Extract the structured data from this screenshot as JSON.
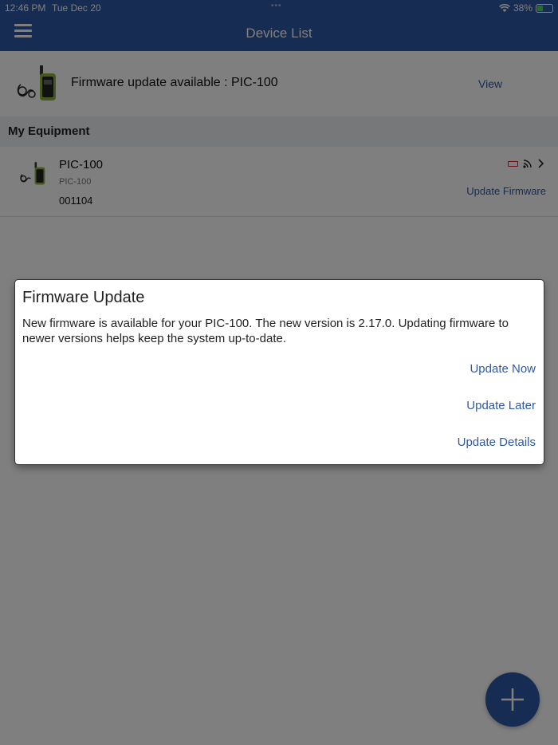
{
  "status_bar": {
    "time": "12:46 PM",
    "date": "Tue Dec 20",
    "battery": "38%",
    "battery_level": 0.38
  },
  "header": {
    "title": "Device List",
    "menu_icon": "hamburger-menu-icon"
  },
  "firmware_banner": {
    "text": "Firmware update available : PIC-100",
    "action": "View"
  },
  "section": {
    "title": "My Equipment"
  },
  "device": {
    "name": "PIC-100",
    "model": "PIC-100",
    "serial": "001104",
    "update_action": "Update Firmware",
    "icons": [
      "low-battery-icon",
      "signal-icon",
      "chevron-right-icon"
    ]
  },
  "dialog": {
    "title": "Firmware Update",
    "body": "New firmware is available for your PIC-100. The new version is 2.17.0. Updating firmware to newer versions helps keep the system up-to-date.",
    "actions": {
      "now": "Update Now",
      "later": "Update Later",
      "details": "Update Details"
    }
  },
  "colors": {
    "primary": "#2f59a7",
    "section_bg": "#eef1f5",
    "low_battery": "#dd2222"
  }
}
